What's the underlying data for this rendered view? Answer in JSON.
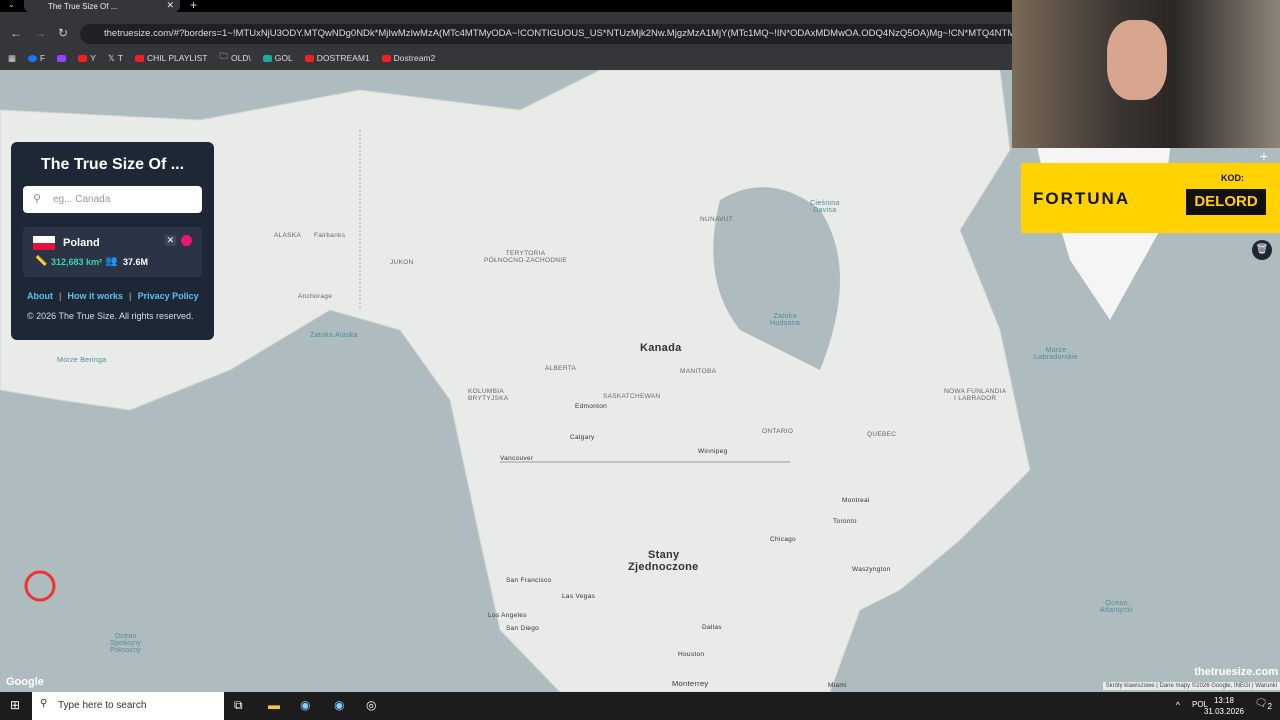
{
  "browser": {
    "tab_title": "The True Size Of ...",
    "url": "thetruesize.com/#?borders=1~!MTUxNjU3ODY.MTQwNDg0NDk*MjIwMzIwMzA(MTc4MTMyODA~!CONTIGUOUS_US*NTUzMjk2Nw.MjgzMzA1MjY(MTc1MQ~!IN*ODAxMDMwOA.ODQ4NzQ5OA)Mg~!CN*MTQ4NTM1M",
    "bookmarks": [
      "F",
      "",
      "Y",
      "T",
      "CHIL PLAYLIST",
      "OLD\\",
      "GOL",
      "DOSTREAM1",
      "Dostream2"
    ]
  },
  "panel": {
    "title": "The True Size Of ...",
    "search_placeholder": "eg... Canada",
    "country": {
      "name": "Poland",
      "area": "312,683 km²",
      "population": "37.6M",
      "color": "#e8196b"
    },
    "links": [
      "About",
      "How it works",
      "Privacy Policy"
    ],
    "copyright": "© 2026 The True Size. All rights reserved."
  },
  "map": {
    "labels": {
      "kanada": "Kanada",
      "usa1": "Stany",
      "usa2": "Zjednoczone",
      "alaska": "ALASKA",
      "fairbanks": "Fairbanks",
      "anchorage": "Anchorage",
      "yukon": "JUKON",
      "nwt": "TERYTORIA\nPÓŁNOCNO-ZACHODNIE",
      "nunavut": "NUNAVUT",
      "alberta": "ALBERTA",
      "bc": "KOLUMBIA\nBRYTYJSKA",
      "sask": "SASKATCHEWAN",
      "manitoba": "MANITOBA",
      "ontario": "ONTARIO",
      "quebec": "QUEBEC",
      "labrador": "NOWA FUNLANDIA\nI LABRADOR",
      "edmonton": "Edmonton",
      "calgary": "Calgary",
      "winnipeg": "Winnipeg",
      "vancouver": "Vancouver",
      "montreal": "Montreal",
      "toronto": "Toronto",
      "chicago": "Chicago",
      "washington": "Waszyngton",
      "sf": "San Francisco",
      "la": "Los Angeles",
      "sd": "San Diego",
      "lv": "Las Vegas",
      "dallas": "Dallas",
      "houston": "Houston",
      "monterrey": "Monterrey",
      "miami": "Miami",
      "zatoka_hudsona": "Zatoka\nHudsona",
      "zatoka_alaska": "Zatoka Alaska",
      "morze_beringa": "Morze Beringa",
      "morze_labradorskie": "Morze\nLabradorskie",
      "ocean_atl": "Ocean\nAtlantycki",
      "ocean_pac": "Ocean\nSpokojny\nPółnocny",
      "ciesnina": "Cieśnina\nDavisa"
    },
    "google": "Google",
    "attribution": [
      "Skróty klawiszowe",
      "Dane mapy ©2026 Google, INEGI",
      "Warunki"
    ],
    "watermark": "thetruesize.com"
  },
  "ad": {
    "brand": "FORTUNA",
    "code_label": "KOD:",
    "code": "DELORD"
  },
  "taskbar": {
    "search_placeholder": "Type here to search",
    "lang": "POL",
    "time": "13:18",
    "date": "31.03.2026",
    "notifications": "2"
  }
}
